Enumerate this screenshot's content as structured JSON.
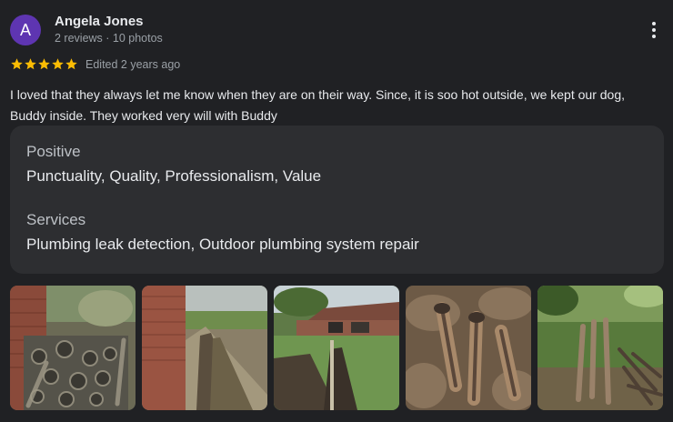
{
  "review": {
    "author_initial": "A",
    "author_name": "Angela Jones",
    "author_meta": "2 reviews · 10 photos",
    "rating": 5,
    "edited": "Edited 2 years ago",
    "text": "I loved that they always let me know when they are on their way. Since, it is soo hot outside, we kept our dog, Buddy inside. They worked very will with Buddy",
    "attributes": [
      {
        "label": "Positive",
        "value": "Punctuality, Quality, Professionalism, Value"
      },
      {
        "label": "Services",
        "value": "Plumbing leak detection, Outdoor plumbing system repair"
      }
    ],
    "photo_count_shown": 5
  },
  "icons": {
    "more": "more-vert-icon",
    "star": "star-icon"
  },
  "colors": {
    "background": "#202124",
    "card": "#2d2e31",
    "avatar": "#5e35b1",
    "star": "#fbbc04",
    "secondary_text": "#9aa0a6"
  }
}
